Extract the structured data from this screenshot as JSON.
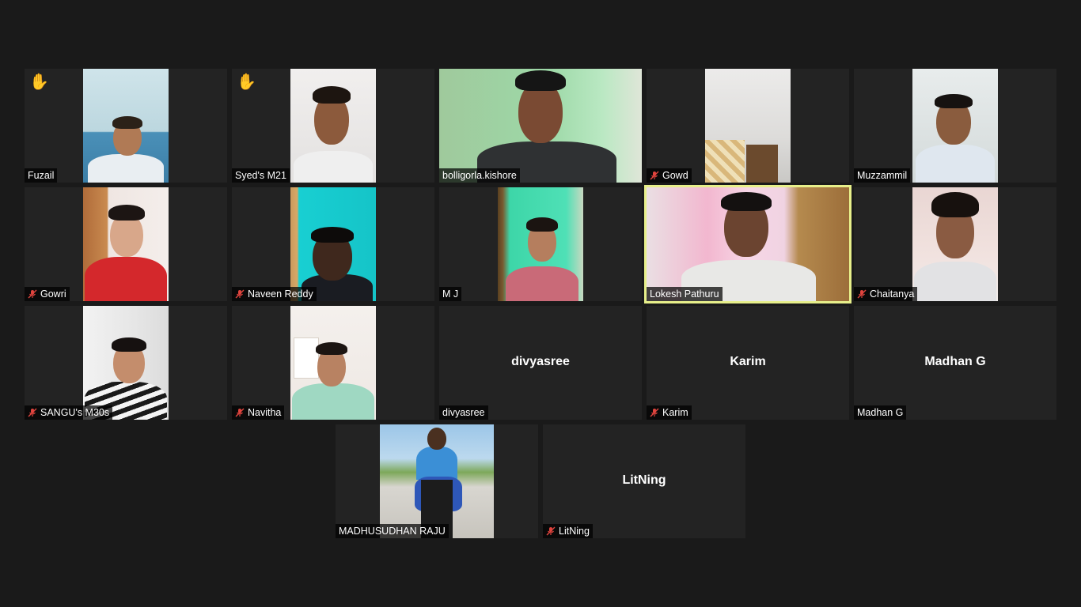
{
  "colors": {
    "background": "#1a1a1a",
    "tile": "#232323",
    "active_speaker_border": "#e7ef8a",
    "muted_icon": "#e0443e",
    "raised_hand": "#f4c430"
  },
  "participants": [
    {
      "name": "Fuzail",
      "muted": false,
      "hand_raised": true,
      "video": true,
      "center_label": ""
    },
    {
      "name": "Syed's M21",
      "muted": false,
      "hand_raised": true,
      "video": true,
      "center_label": ""
    },
    {
      "name": "bolligorla.kishore",
      "muted": false,
      "hand_raised": false,
      "video": true,
      "center_label": ""
    },
    {
      "name": "Gowd",
      "muted": true,
      "hand_raised": false,
      "video": true,
      "center_label": ""
    },
    {
      "name": "Muzzammil",
      "muted": false,
      "hand_raised": false,
      "video": true,
      "center_label": ""
    },
    {
      "name": "Gowri",
      "muted": true,
      "hand_raised": false,
      "video": true,
      "center_label": ""
    },
    {
      "name": "Naveen Reddy",
      "muted": true,
      "hand_raised": false,
      "video": true,
      "center_label": ""
    },
    {
      "name": "M J",
      "muted": false,
      "hand_raised": false,
      "video": true,
      "center_label": ""
    },
    {
      "name": "Lokesh Pathuru",
      "muted": false,
      "hand_raised": false,
      "video": true,
      "center_label": "",
      "active_speaker": true
    },
    {
      "name": "Chaitanya",
      "muted": true,
      "hand_raised": false,
      "video": true,
      "center_label": ""
    },
    {
      "name": "SANGU's M30s",
      "muted": true,
      "hand_raised": false,
      "video": true,
      "center_label": ""
    },
    {
      "name": "Navitha",
      "muted": true,
      "hand_raised": false,
      "video": true,
      "center_label": ""
    },
    {
      "name": "divyasree",
      "muted": false,
      "hand_raised": false,
      "video": false,
      "center_label": "divyasree"
    },
    {
      "name": "Karim",
      "muted": true,
      "hand_raised": false,
      "video": false,
      "center_label": "Karim"
    },
    {
      "name": "Madhan G",
      "muted": false,
      "hand_raised": false,
      "video": false,
      "center_label": "Madhan G"
    },
    {
      "name": "MADHUSUDHAN RAJU",
      "muted": false,
      "hand_raised": false,
      "video": true,
      "center_label": ""
    },
    {
      "name": "LitNing",
      "muted": true,
      "hand_raised": false,
      "video": false,
      "center_label": "LitNing"
    }
  ],
  "icons": {
    "raised_hand": "✋",
    "muted_mic": "muted-mic-icon"
  }
}
